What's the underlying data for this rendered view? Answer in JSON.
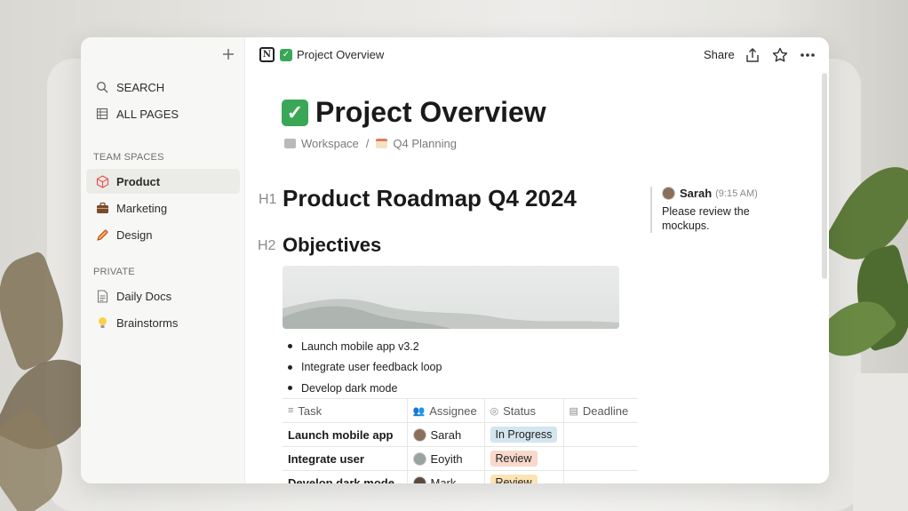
{
  "sidebar": {
    "new_page_icon": "plus-icon",
    "top_items": [
      {
        "label": "SEARCH",
        "icon": "search-icon"
      },
      {
        "label": "ALL PAGES",
        "icon": "table-icon"
      }
    ],
    "sections": [
      {
        "title": "TEAM SPACES",
        "items": [
          {
            "label": "Product",
            "icon": "cube-icon",
            "active": true
          },
          {
            "label": "Marketing",
            "icon": "briefcase-icon"
          },
          {
            "label": "Design",
            "icon": "pencil-icon"
          }
        ]
      },
      {
        "title": "PRIVATE",
        "items": [
          {
            "label": "Daily Docs",
            "icon": "document-icon"
          },
          {
            "label": "Brainstorms",
            "icon": "lightbulb-icon"
          }
        ]
      }
    ]
  },
  "topbar": {
    "page_name": "Project Overview",
    "share_label": "Share"
  },
  "page": {
    "title": "Project Overview",
    "breadcrumb": [
      "Workspace",
      "Q4 Planning"
    ],
    "h1_marker": "H1",
    "h1": "Product Roadmap Q4 2024",
    "h2_marker": "H2",
    "h2": "Objectives",
    "bullets": [
      "Launch mobile app v3.2",
      "Integrate user feedback loop",
      "Develop dark mode"
    ]
  },
  "comment": {
    "author": "Sarah",
    "time": "(9:15 AM)",
    "text": "Please review the mockups."
  },
  "table": {
    "columns": [
      "Task",
      "Assignee",
      "Status",
      "Deadline"
    ],
    "rows": [
      {
        "task": "Launch mobile app",
        "assignee": "Sarah",
        "status": "In Progress",
        "status_color": "#d3e5ef",
        "deadline": ""
      },
      {
        "task": "Integrate user",
        "assignee": "Eoyith",
        "status": "Review",
        "status_color": "#f8d9cc",
        "deadline": ""
      },
      {
        "task": "Develop dark mode",
        "assignee": "Mark",
        "status": "Review",
        "status_color": "#fbe3b4",
        "deadline": ""
      }
    ]
  },
  "help_label": "?",
  "colors": {
    "accent_check": "#3aa757",
    "sidebar_bg": "#f7f7f5"
  }
}
